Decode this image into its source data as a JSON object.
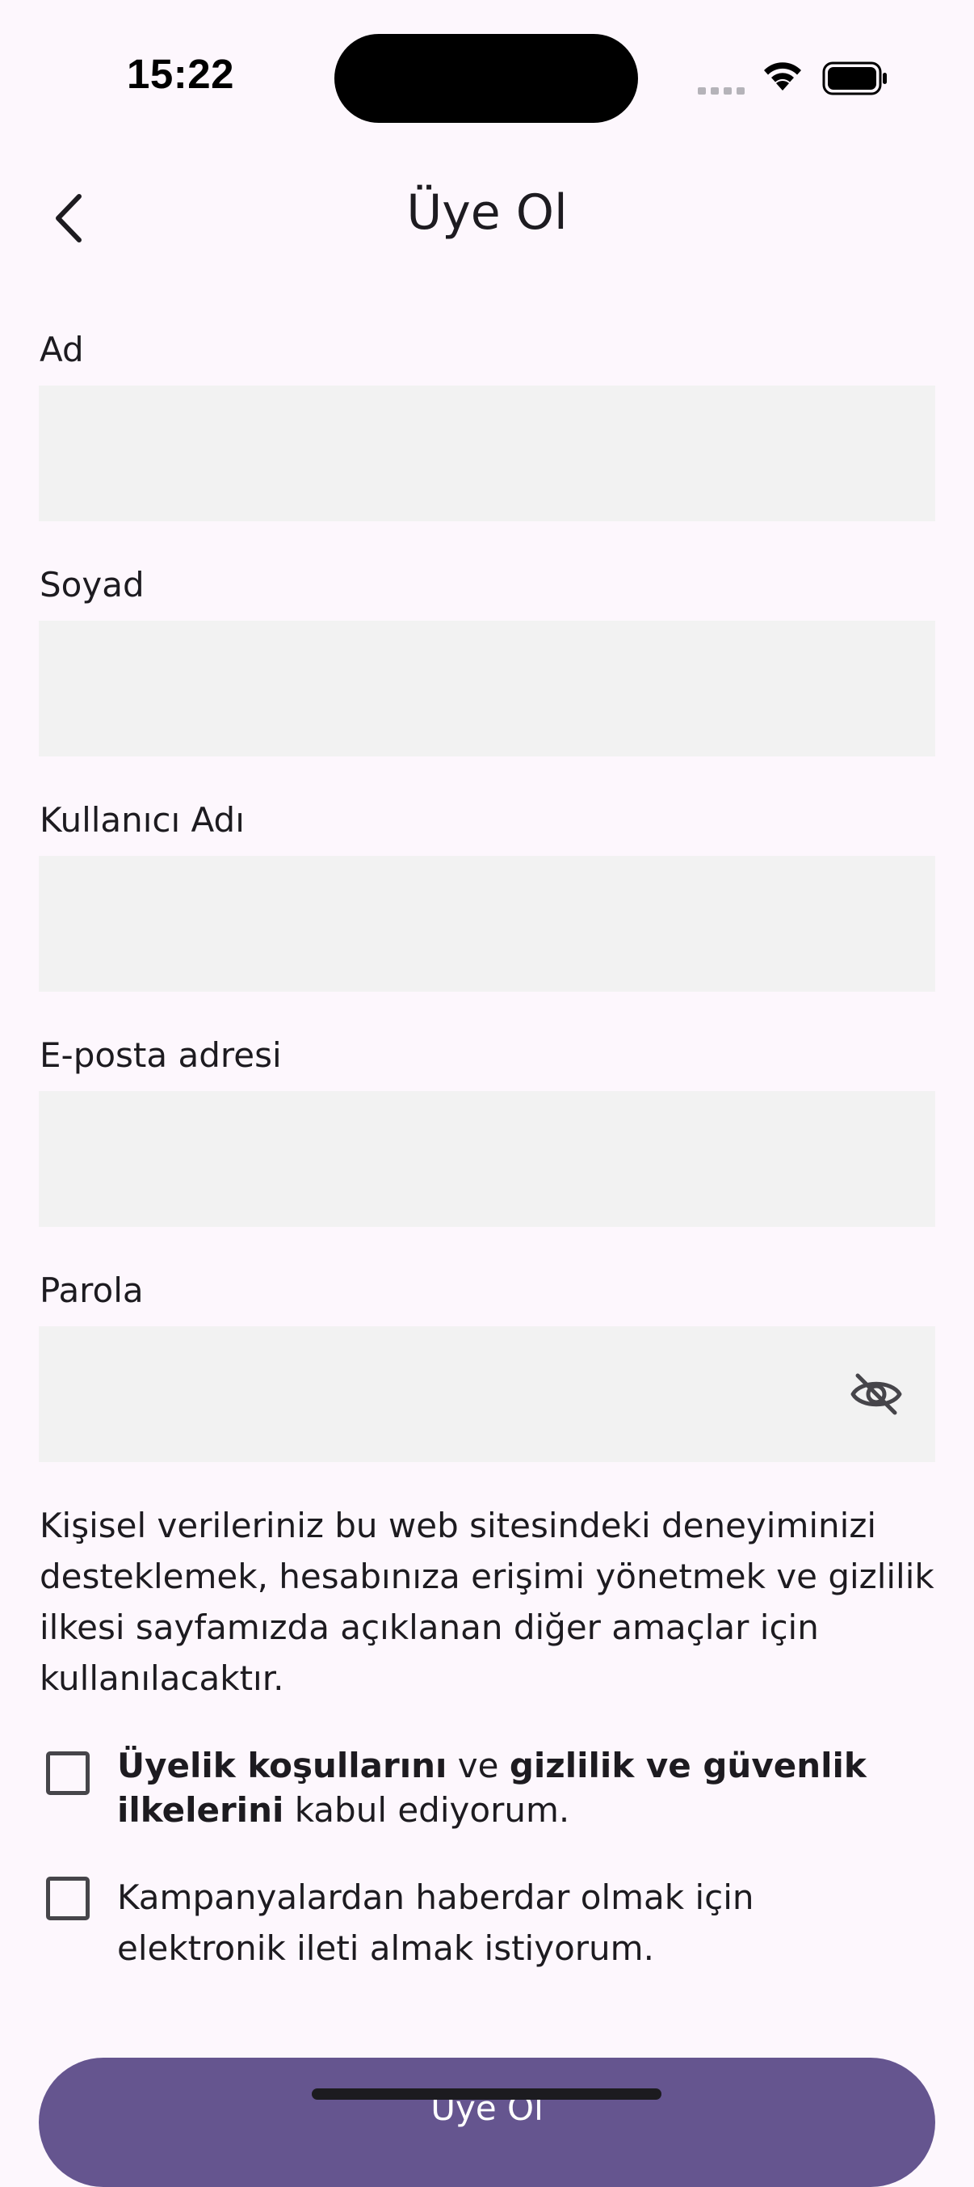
{
  "status_bar": {
    "time": "15:22",
    "icons": [
      "cellular-signal-icon",
      "wifi-icon",
      "battery-icon"
    ]
  },
  "app_bar": {
    "back_icon": "chevron-left-icon",
    "title": "Üye Ol"
  },
  "form": {
    "fields": [
      {
        "label": "Ad",
        "value": ""
      },
      {
        "label": "Soyad",
        "value": ""
      },
      {
        "label": "Kullanıcı Adı",
        "value": ""
      },
      {
        "label": "E-posta adresi",
        "value": ""
      },
      {
        "label": "Parola",
        "value": "",
        "toggle_icon": "eye-off-icon"
      }
    ],
    "privacy_notice": "Kişisel verileriniz bu web sitesindeki deneyiminizi desteklemek, hesabınıza erişimi yönetmek ve gizlilik ilkesi sayfamızda açıklanan diğer amaçlar için kullanılacaktır.",
    "terms_checkbox": {
      "checked": false,
      "bold_1": "Üyelik koşullarını",
      "mid": " ve ",
      "bold_2": "gizlilik ve güvenlik ilkelerini",
      "tail": " kabul ediyorum."
    },
    "marketing_checkbox": {
      "checked": false,
      "label": "Kampanyalardan haberdar olmak için elektronik ileti almak istiyorum."
    },
    "submit_label": "Üye Ol"
  },
  "colors": {
    "background": "#FDF7FD",
    "field_fill": "#F2F2F2",
    "primary": "#65558F",
    "on_surface": "#1D1B20"
  }
}
